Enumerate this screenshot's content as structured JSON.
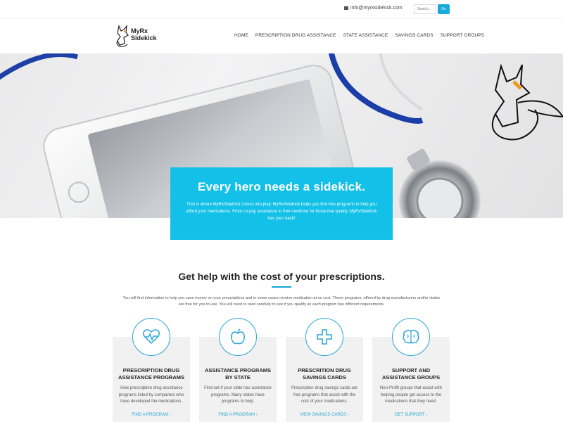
{
  "topbar": {
    "email": "info@myrxsidekick.com",
    "search_placeholder": "Search...",
    "go_label": "Go"
  },
  "header": {
    "logo_line1": "MyRx",
    "logo_line2": "Sidekick",
    "nav": [
      "HOME",
      "PRESCRIPTION DRUG ASSISTANCE",
      "STATE ASSISTANCE",
      "SAVINGS CARDS",
      "SUPPORT GROUPS"
    ]
  },
  "hero": {
    "title": "Every hero needs a sidekick.",
    "body": "That is where MyRxSideKick comes into play. MyRxSideKick helps you find free programs to help you afford your medications. From co-pay assistance to free medicine for those that qualify, MyRxSideKick has your back!"
  },
  "section": {
    "title": "Get help with the cost of your prescriptions.",
    "body": "You will find information to help you save money on your prescriptions and in some cases receive medication at no cost. These programs, offered by drug manufacturers and/or states are free for you to use. You will need to read carefully to see if you qualify as each program has different requirements."
  },
  "cards": [
    {
      "icon": "heart-pulse-icon",
      "title_line1": "PRESCRIPTION DRUG",
      "title_line2": "ASSISTANCE PROGRAMS",
      "text": "View prescription drug assistance programs listed by companies who have developed the medications.",
      "link": "FIND A PROGRAM"
    },
    {
      "icon": "apple-icon",
      "title_line1": "ASSISTANCE PROGRAMS",
      "title_line2": "BY STATE",
      "text": "Find out if your state has assistance programs. Many states have programs to help.",
      "link": "FIND A PROGRAM"
    },
    {
      "icon": "medical-cross-icon",
      "title_line1": "PRESCRITION DRUG",
      "title_line2": "SAVINGS CARDS",
      "text": "Prescription drug savings cards are free programs that assist with the cost of your medications.",
      "link": "VIEW SAVINGS CARDS"
    },
    {
      "icon": "brain-icon",
      "title_line1": "SUPPORT AND",
      "title_line2": "ASSISTANCE GROUPS",
      "text": "Non-Profit groups that assist with helping people get access to the medications that they need.",
      "link": "GET SUPPORT"
    }
  ],
  "colors": {
    "accent": "#12c0e8",
    "link": "#2aa5d5",
    "card_bg": "#f1f1f1"
  }
}
